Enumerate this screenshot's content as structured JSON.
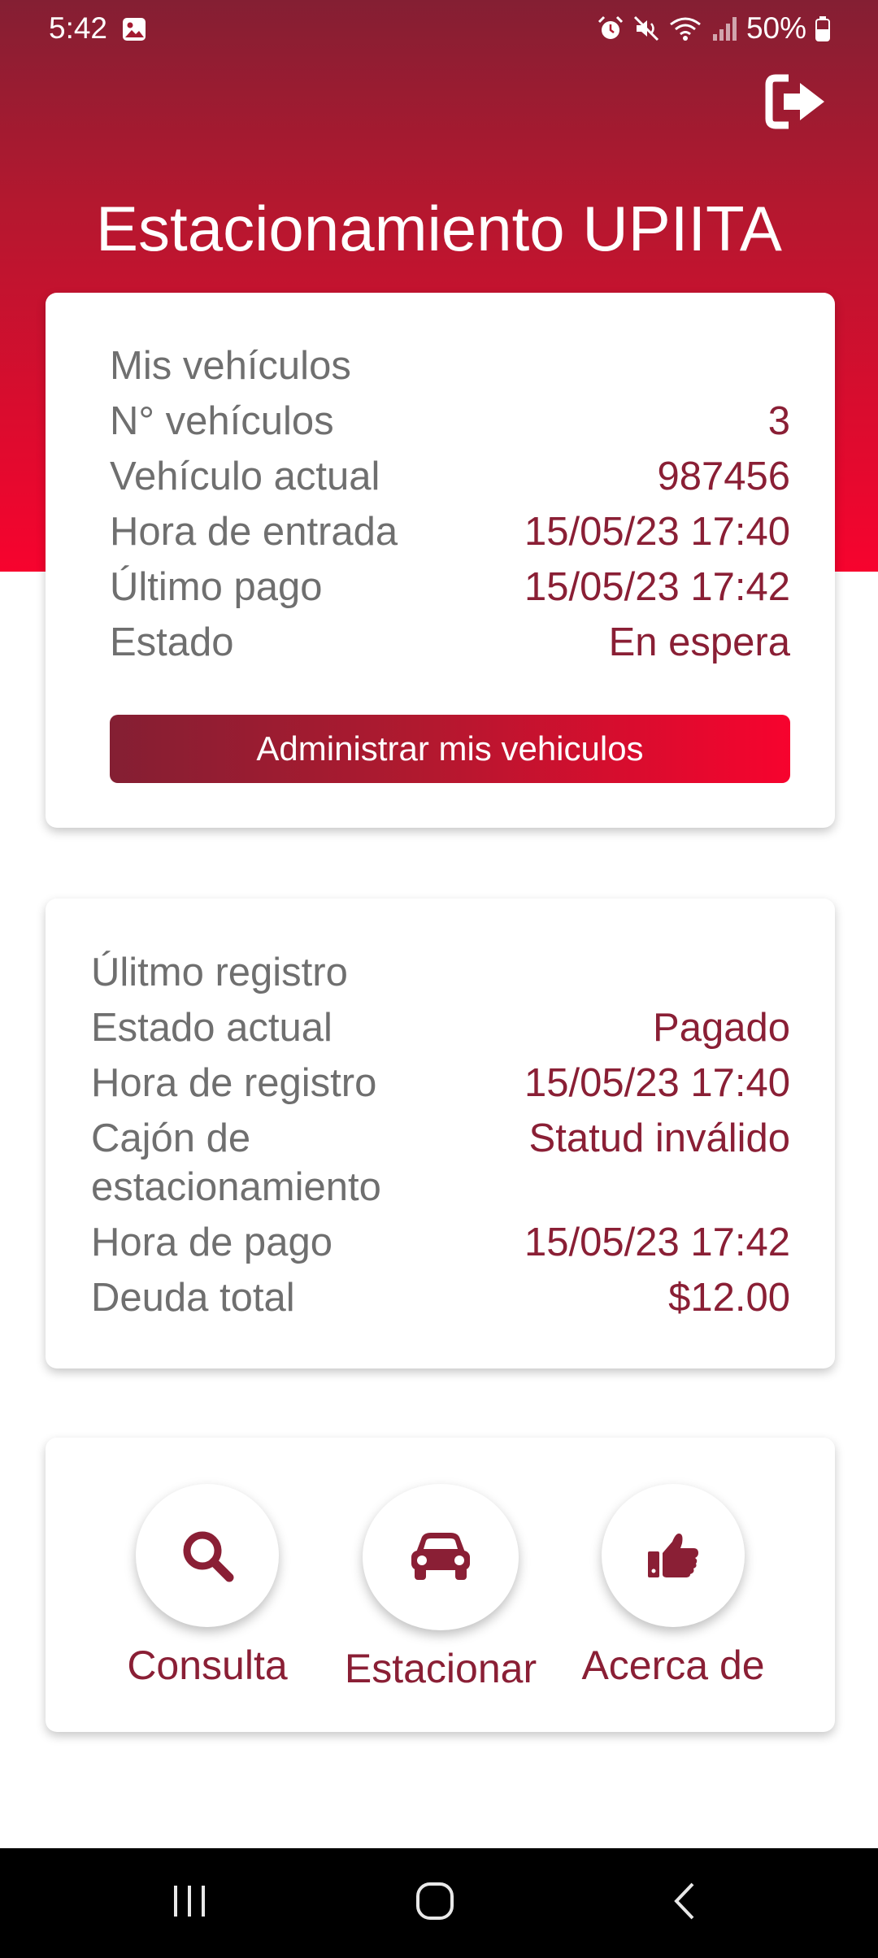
{
  "status_bar": {
    "time": "5:42",
    "battery": "50%",
    "icons": [
      "image-icon",
      "alarm-icon",
      "mute-icon",
      "wifi-icon",
      "signal-icon",
      "battery-icon"
    ]
  },
  "header": {
    "title": "Estacionamiento UPIITA",
    "logout_icon": "logout-icon"
  },
  "vehicles_card": {
    "heading": "Mis vehículos",
    "rows": [
      {
        "label": "N° vehículos",
        "value": "3"
      },
      {
        "label": "Vehículo actual",
        "value": "987456"
      },
      {
        "label": "Hora de entrada",
        "value": "15/05/23 17:40"
      },
      {
        "label": "Último pago",
        "value": "15/05/23 17:42"
      },
      {
        "label": "Estado",
        "value": "En espera"
      }
    ],
    "button_label": "Administrar mis vehiculos"
  },
  "record_card": {
    "heading": "Úlitmo registro",
    "rows": [
      {
        "label": "Estado actual",
        "value": "Pagado"
      },
      {
        "label": "Hora de registro",
        "value": "15/05/23 17:40"
      },
      {
        "label_line1": "Cajón de",
        "label_line2": "estacionamiento",
        "value": "Statud inválido"
      },
      {
        "label": "Hora de pago",
        "value": "15/05/23 17:42"
      },
      {
        "label": "Deuda total",
        "value": "$12.00"
      }
    ]
  },
  "actions": [
    {
      "label": "Consulta",
      "icon": "search-icon"
    },
    {
      "label": "Estacionar",
      "icon": "car-icon"
    },
    {
      "label": "Acerca de",
      "icon": "thumbs-up-icon"
    }
  ],
  "nav_bar": {
    "icons": [
      "recent-apps-icon",
      "home-icon",
      "back-icon"
    ]
  },
  "colors": {
    "primary_dark": "#841f33",
    "primary_bright": "#f7032e",
    "value_text": "#8a1f35",
    "label_text": "#6f6f6f"
  }
}
